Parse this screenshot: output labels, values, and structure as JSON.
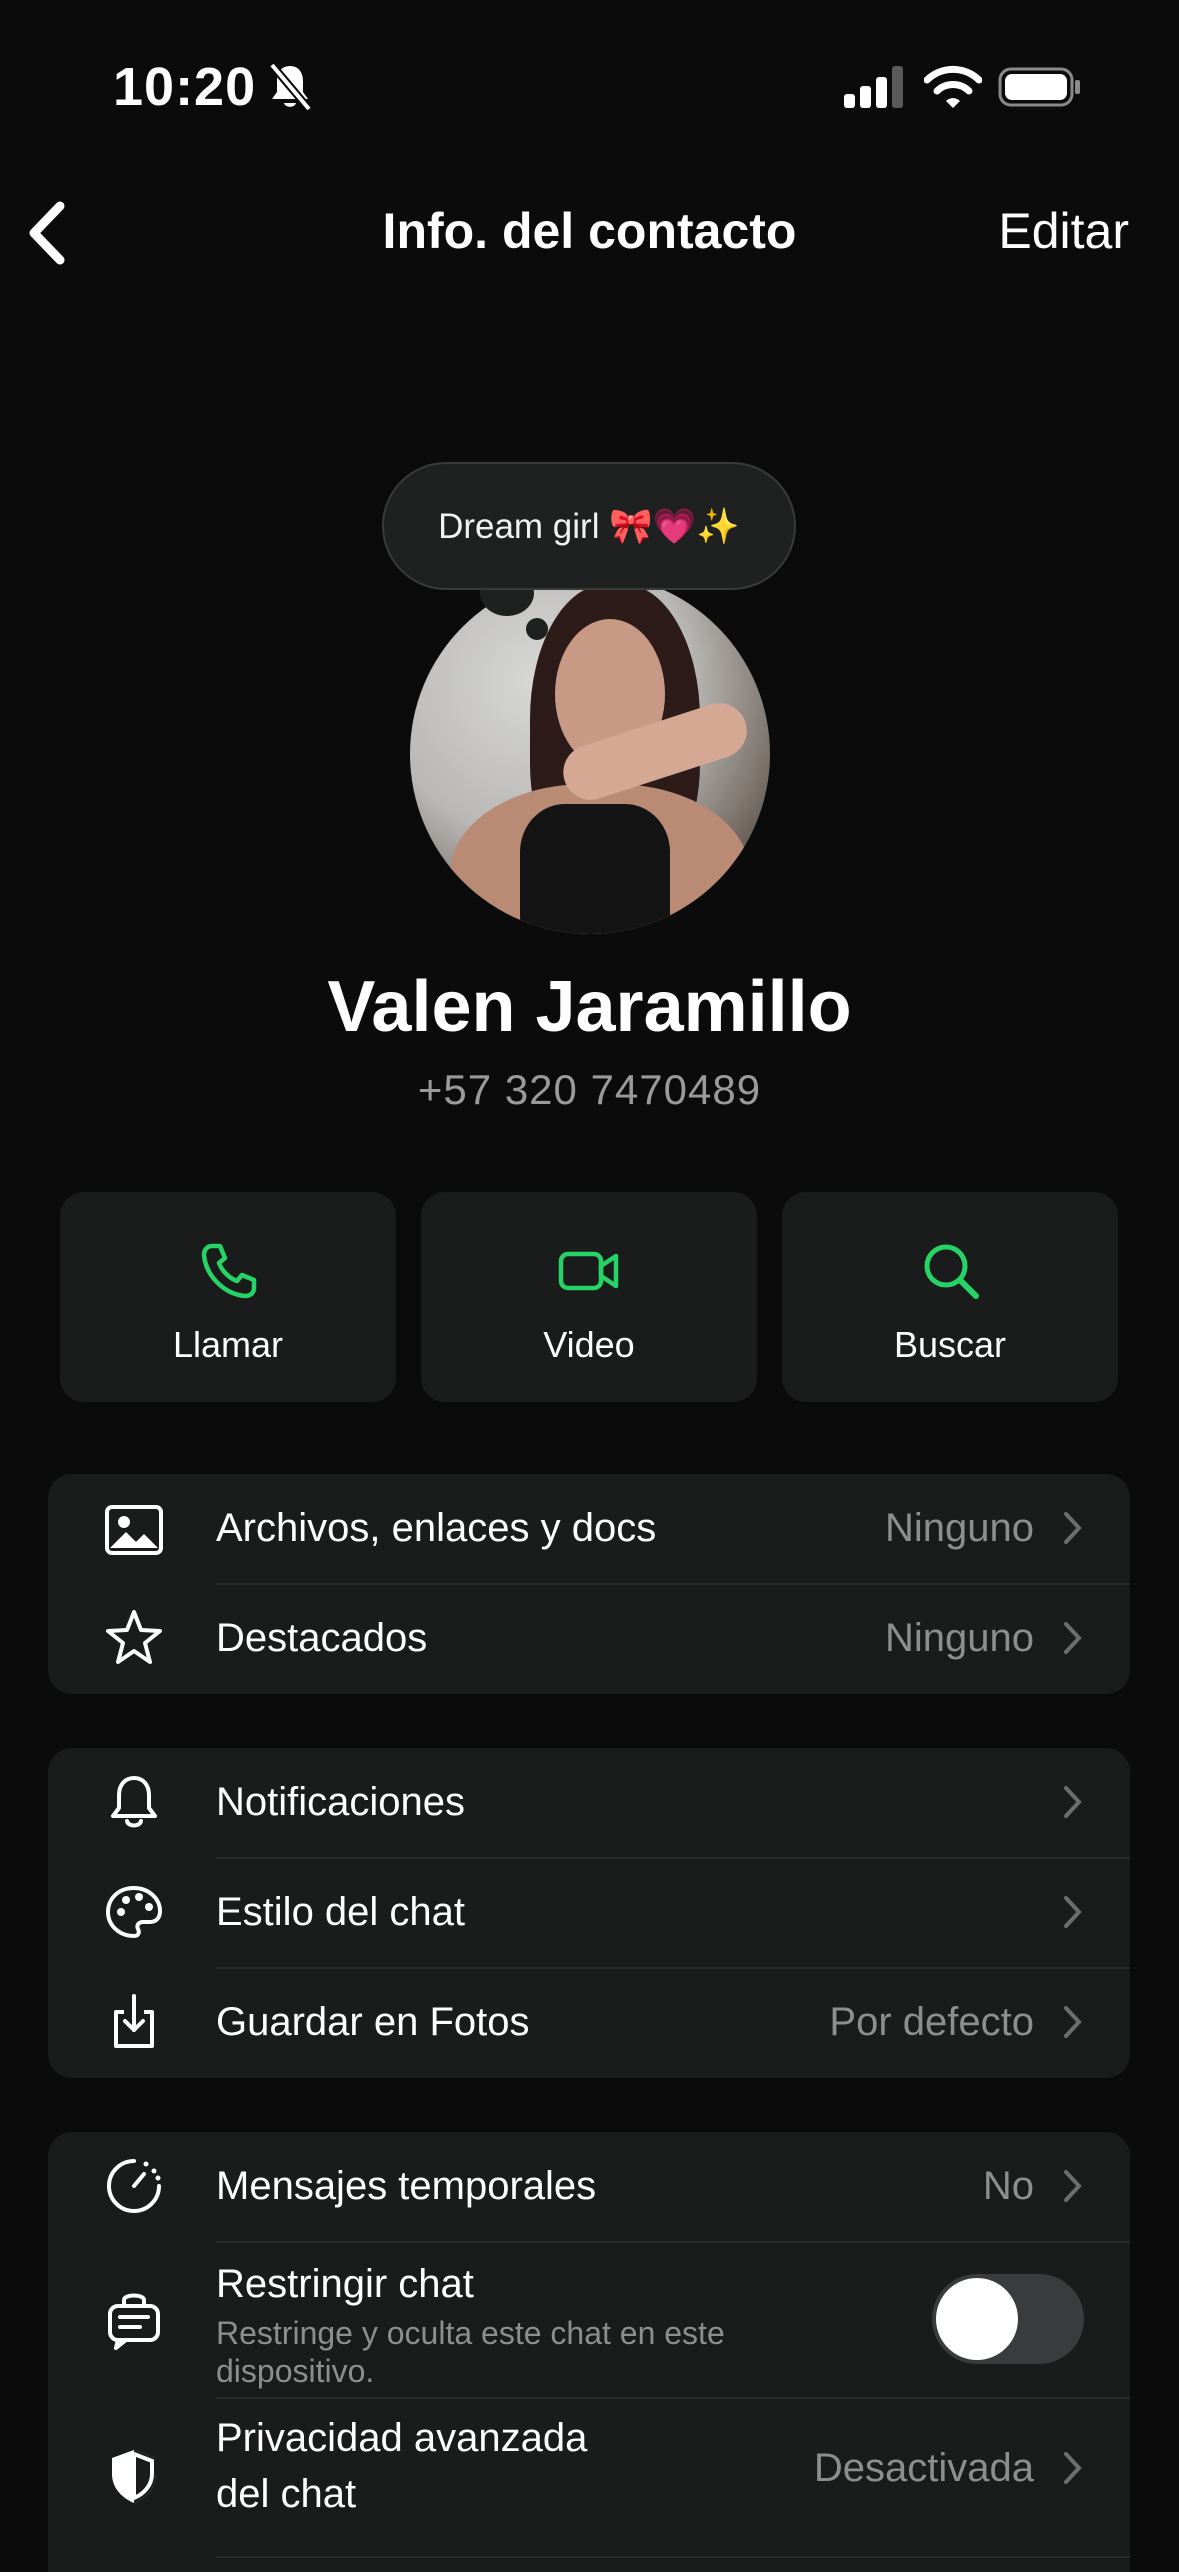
{
  "status_bar": {
    "time": "10:20"
  },
  "nav": {
    "title": "Info. del contacto",
    "edit_label": "Editar"
  },
  "profile": {
    "status_note": "Dream girl 🎀💗✨",
    "name": "Valen Jaramillo",
    "phone": "+57 320 7470489"
  },
  "actions": [
    {
      "label": "Llamar",
      "icon": "phone-icon"
    },
    {
      "label": "Video",
      "icon": "video-icon"
    },
    {
      "label": "Buscar",
      "icon": "search-icon"
    }
  ],
  "group1": [
    {
      "label": "Archivos, enlaces y docs",
      "value": "Ninguno",
      "icon": "image-icon"
    },
    {
      "label": "Destacados",
      "value": "Ninguno",
      "icon": "star-icon"
    }
  ],
  "group2": [
    {
      "label": "Notificaciones",
      "value": "",
      "icon": "bell-icon"
    },
    {
      "label": "Estilo del chat",
      "value": "",
      "icon": "palette-icon"
    },
    {
      "label": "Guardar en Fotos",
      "value": "Por defecto",
      "icon": "download-icon"
    }
  ],
  "group3": {
    "temp": {
      "label": "Mensajes temporales",
      "value": "No",
      "icon": "timer-icon"
    },
    "restrict": {
      "label": "Restringir chat",
      "sub": "Restringe y oculta este chat en este dispositivo.",
      "icon": "lock-chat-icon",
      "enabled": false
    },
    "privacy": {
      "label_line1": "Privacidad avanzada",
      "label_line2": "del chat",
      "value": "Desactivada",
      "icon": "shield-icon"
    }
  },
  "colors": {
    "accent": "#25d366",
    "background": "#0b0b0b",
    "card": "#1a1b1b",
    "secondary_text": "#8e8e8e"
  }
}
